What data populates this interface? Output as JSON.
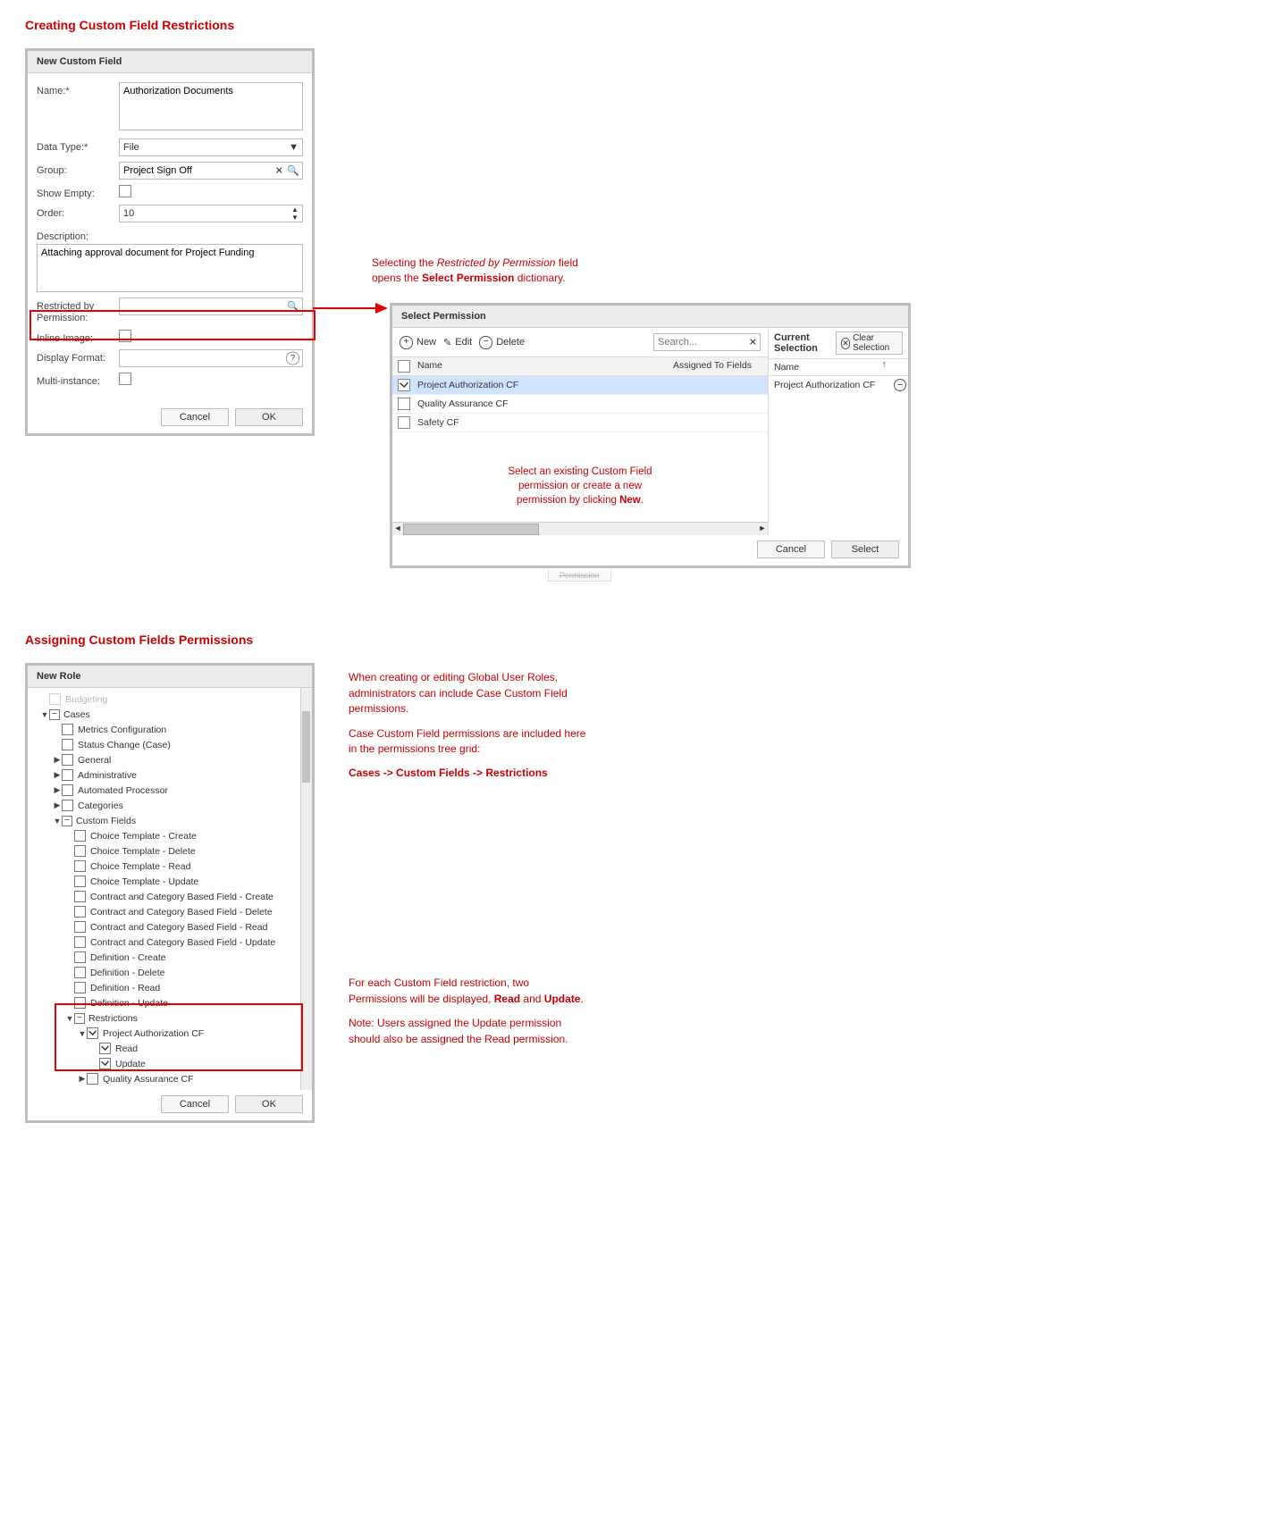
{
  "section1": {
    "heading": "Creating Custom Field Restrictions",
    "dialog_title": "New Custom Field",
    "labels": {
      "name": "Name:*",
      "data_type": "Data Type:*",
      "group": "Group:",
      "show_empty": "Show Empty:",
      "order": "Order:",
      "description": "Description:",
      "restricted_by_permission": "Restricted by Permission:",
      "inline_image": "Inline Image:",
      "display_format": "Display Format:",
      "multi_instance": "Multi-instance:"
    },
    "values": {
      "name": "Authorization Documents",
      "data_type": "File",
      "group": "Project Sign Off",
      "order": "10",
      "description": "Attaching approval document for Project Funding",
      "restricted_by_permission": "",
      "display_format": ""
    },
    "buttons": {
      "cancel": "Cancel",
      "ok": "OK"
    },
    "annotation": {
      "line1_pre": "Selecting the ",
      "line1_em": "Restricted by Permission",
      "line1_post": " field",
      "line2_pre": "opens the ",
      "line2_b": "Select Permission",
      "line2_post": " dictionary."
    }
  },
  "select_permission": {
    "title": "Select Permission",
    "toolbar": {
      "new": "New",
      "edit": "Edit",
      "delete": "Delete"
    },
    "search_placeholder": "Search...",
    "columns": {
      "name": "Name",
      "assigned": "Assigned To Fields"
    },
    "rows": [
      {
        "name": "Project Authorization CF",
        "checked": true,
        "selected": true
      },
      {
        "name": "Quality Assurance CF",
        "checked": false,
        "selected": false
      },
      {
        "name": "Safety CF",
        "checked": false,
        "selected": false
      }
    ],
    "hint": {
      "l1": "Select an existing Custom Field",
      "l2": "permission or create a new",
      "l3_pre": "permission by clicking ",
      "l3_b": "New",
      "l3_post": "."
    },
    "current_selection": {
      "header": "Current Selection",
      "clear": "Clear Selection",
      "name_col": "Name",
      "items": [
        "Project Authorization CF"
      ]
    },
    "footer": {
      "cancel": "Cancel",
      "select": "Select"
    },
    "cutoff_word": "Permission"
  },
  "section2": {
    "heading": "Assigning Custom Fields Permissions",
    "dialog_title": "New Role",
    "tree": [
      {
        "depth": 1,
        "disclosure": "",
        "pm": "",
        "cb": "unchecked",
        "label": "Budgeting",
        "faded": true
      },
      {
        "depth": 1,
        "disclosure": "▼",
        "pm": "−",
        "cb": "",
        "label": "Cases"
      },
      {
        "depth": 2,
        "disclosure": "",
        "pm": "",
        "cb": "unchecked",
        "label": "Metrics Configuration"
      },
      {
        "depth": 2,
        "disclosure": "",
        "pm": "",
        "cb": "unchecked",
        "label": "Status Change (Case)"
      },
      {
        "depth": 2,
        "disclosure": "▶",
        "pm": "",
        "cb": "unchecked",
        "label": "General"
      },
      {
        "depth": 2,
        "disclosure": "▶",
        "pm": "",
        "cb": "unchecked",
        "label": "Administrative"
      },
      {
        "depth": 2,
        "disclosure": "▶",
        "pm": "",
        "cb": "unchecked",
        "label": "Automated Processor"
      },
      {
        "depth": 2,
        "disclosure": "▶",
        "pm": "",
        "cb": "unchecked",
        "label": "Categories"
      },
      {
        "depth": 2,
        "disclosure": "▼",
        "pm": "−",
        "cb": "",
        "label": "Custom Fields"
      },
      {
        "depth": 3,
        "disclosure": "",
        "pm": "",
        "cb": "unchecked",
        "label": "Choice Template - Create"
      },
      {
        "depth": 3,
        "disclosure": "",
        "pm": "",
        "cb": "unchecked",
        "label": "Choice Template - Delete"
      },
      {
        "depth": 3,
        "disclosure": "",
        "pm": "",
        "cb": "unchecked",
        "label": "Choice Template - Read"
      },
      {
        "depth": 3,
        "disclosure": "",
        "pm": "",
        "cb": "unchecked",
        "label": "Choice Template - Update"
      },
      {
        "depth": 3,
        "disclosure": "",
        "pm": "",
        "cb": "unchecked",
        "label": "Contract and Category Based Field - Create"
      },
      {
        "depth": 3,
        "disclosure": "",
        "pm": "",
        "cb": "unchecked",
        "label": "Contract and Category Based Field - Delete"
      },
      {
        "depth": 3,
        "disclosure": "",
        "pm": "",
        "cb": "unchecked",
        "label": "Contract and Category Based Field - Read"
      },
      {
        "depth": 3,
        "disclosure": "",
        "pm": "",
        "cb": "unchecked",
        "label": "Contract and Category Based Field - Update"
      },
      {
        "depth": 3,
        "disclosure": "",
        "pm": "",
        "cb": "unchecked",
        "label": "Definition - Create"
      },
      {
        "depth": 3,
        "disclosure": "",
        "pm": "",
        "cb": "unchecked",
        "label": "Definition - Delete"
      },
      {
        "depth": 3,
        "disclosure": "",
        "pm": "",
        "cb": "unchecked",
        "label": "Definition - Read"
      },
      {
        "depth": 3,
        "disclosure": "",
        "pm": "",
        "cb": "unchecked",
        "label": "Definition - Update"
      },
      {
        "depth": 3,
        "disclosure": "▼",
        "pm": "−",
        "cb": "",
        "label": "Restrictions"
      },
      {
        "depth": 4,
        "disclosure": "▼",
        "pm": "",
        "cb": "checked",
        "label": "Project Authorization CF"
      },
      {
        "depth": 5,
        "disclosure": "",
        "pm": "",
        "cb": "checked",
        "label": "Read"
      },
      {
        "depth": 5,
        "disclosure": "",
        "pm": "",
        "cb": "checked",
        "label": "Update"
      },
      {
        "depth": 4,
        "disclosure": "▶",
        "pm": "",
        "cb": "unchecked",
        "label": "Quality Assurance CF"
      }
    ],
    "buttons": {
      "cancel": "Cancel",
      "ok": "OK"
    },
    "annot_top": {
      "p1": "When creating or editing Global User Roles, administrators can include Case Custom Field permissions.",
      "p2": "Case Custom Field permissions are included here in the permissions tree grid:",
      "p3": "Cases -> Custom Fields -> Restrictions"
    },
    "annot_bottom": {
      "l1_pre": "For each Custom Field restriction, two Permissions will be displayed, ",
      "l1_b1": "Read",
      "l1_mid": " and ",
      "l1_b2": "Update",
      "l1_post": ".",
      "l2": "Note: Users assigned the Update permission should also be assigned the Read permission."
    }
  }
}
